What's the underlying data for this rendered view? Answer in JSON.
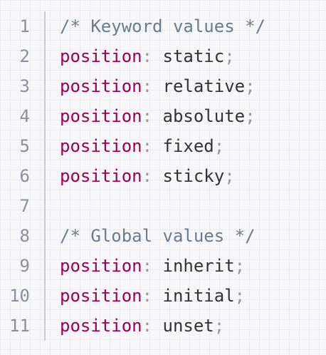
{
  "code": {
    "lines": [
      {
        "number": "1",
        "comment": "/* Keyword values */"
      },
      {
        "number": "2",
        "property": "position",
        "colon": ":",
        "value": " static",
        "semi": ";"
      },
      {
        "number": "3",
        "property": "position",
        "colon": ":",
        "value": " relative",
        "semi": ";"
      },
      {
        "number": "4",
        "property": "position",
        "colon": ":",
        "value": " absolute",
        "semi": ";"
      },
      {
        "number": "5",
        "property": "position",
        "colon": ":",
        "value": " fixed",
        "semi": ";"
      },
      {
        "number": "6",
        "property": "position",
        "colon": ":",
        "value": " sticky",
        "semi": ";"
      },
      {
        "number": "7"
      },
      {
        "number": "8",
        "comment": "/* Global values */"
      },
      {
        "number": "9",
        "property": "position",
        "colon": ":",
        "value": " inherit",
        "semi": ";"
      },
      {
        "number": "10",
        "property": "position",
        "colon": ":",
        "value": " initial",
        "semi": ";"
      },
      {
        "number": "11",
        "property": "position",
        "colon": ":",
        "value": " unset",
        "semi": ";"
      }
    ]
  },
  "colors": {
    "property": "#990055",
    "punctuation": "#999999",
    "value": "#333333",
    "comment": "#6a7c8f",
    "line_number": "#8a919a",
    "background": "#f7f7f9"
  }
}
